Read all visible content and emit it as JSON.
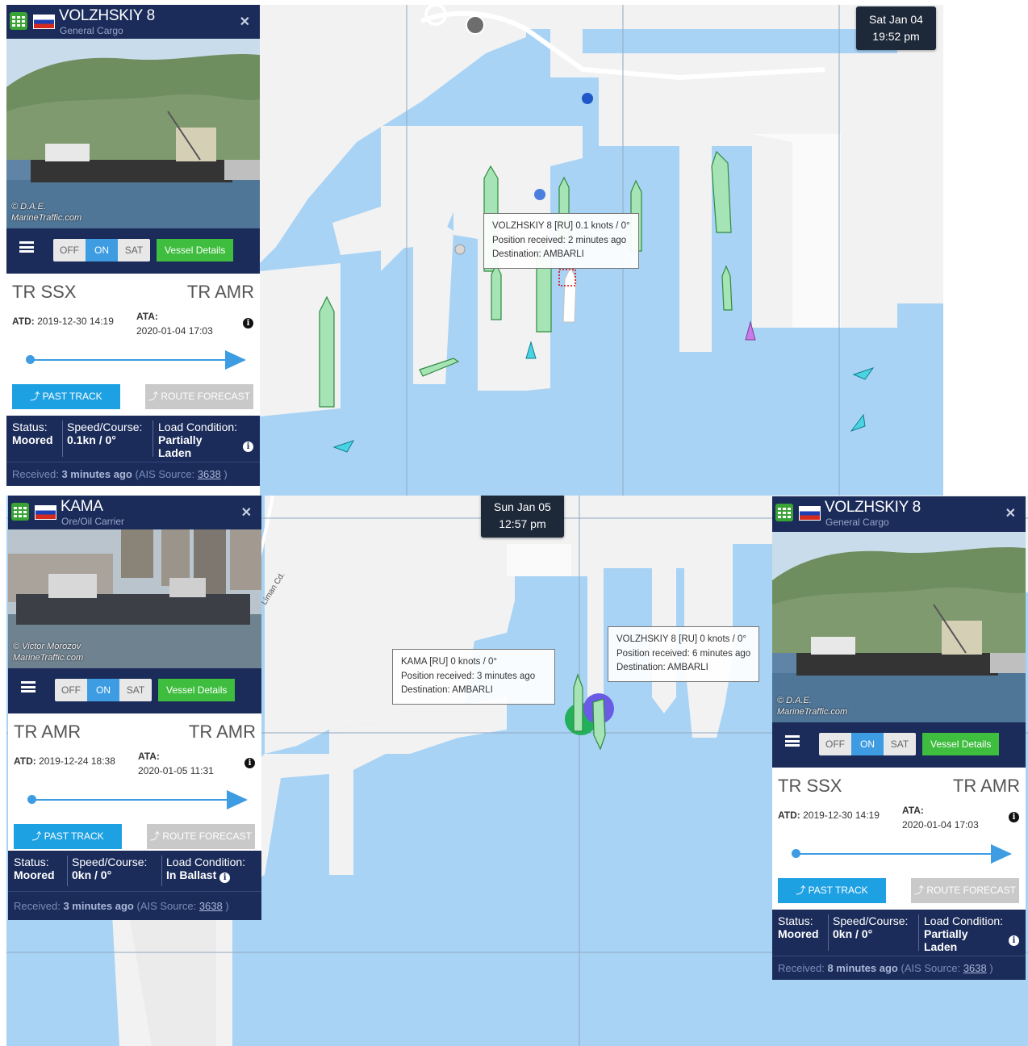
{
  "frames": {
    "top": {
      "clock": {
        "day": "Sat Jan 04",
        "time": "19:52 pm"
      },
      "tooltip": {
        "line1": "VOLZHSKIY 8 [RU] 0.1 knots / 0°",
        "line2": "Position received: 2 minutes ago",
        "line3": "Destination: AMBARLI"
      },
      "panel": {
        "name": "VOLZHSKIY 8",
        "type": "General Cargo",
        "photo_credit_1": "© D.A.E.",
        "photo_credit_2": "MarineTraffic.com",
        "toggle": [
          "OFF",
          "ON",
          "SAT"
        ],
        "toggle_active": "ON",
        "vessel_details": "Vessel Details",
        "from": "TR SSX",
        "to": "TR AMR",
        "atd_label": "ATD:",
        "atd_value": "2019-12-30 14:19",
        "ata_label": "ATA:",
        "ata_value": "2020-01-04 17:03",
        "past_track": "PAST TRACK",
        "route_forecast": "ROUTE FORECAST",
        "status_label": "Status:",
        "status_value": "Moored",
        "speed_label": "Speed/Course:",
        "speed_value": "0.1kn / 0°",
        "load_label": "Load Condition:",
        "load_value_1": "Partially",
        "load_value_2": "Laden",
        "received_label": "Received:",
        "received_value": "3 minutes ago",
        "ais_label": "(AIS Source:",
        "ais_value": "3638",
        "ais_close": ")"
      }
    },
    "bottom": {
      "clock": {
        "day": "Sun Jan 05",
        "time": "12:57 pm"
      },
      "road_label": "Liman Cd.",
      "tooltip_kama": {
        "line1": "KAMA [RU] 0 knots / 0°",
        "line2": "Position received: 3 minutes ago",
        "line3": "Destination: AMBARLI"
      },
      "tooltip_volz": {
        "line1": "VOLZHSKIY 8 [RU] 0 knots / 0°",
        "line2": "Position received: 6 minutes ago",
        "line3": "Destination: AMBARLI"
      },
      "panel_kama": {
        "name": "KAMA",
        "type": "Ore/Oil Carrier",
        "photo_credit_1": "© Victor Morozov",
        "photo_credit_2": "MarineTraffic.com",
        "toggle": [
          "OFF",
          "ON",
          "SAT"
        ],
        "vessel_details": "Vessel Details",
        "from": "TR AMR",
        "to": "TR AMR",
        "atd_label": "ATD:",
        "atd_value": "2019-12-24 18:38",
        "ata_label": "ATA:",
        "ata_value": "2020-01-05 11:31",
        "past_track": "PAST TRACK",
        "route_forecast": "ROUTE FORECAST",
        "status_label": "Status:",
        "status_value": "Moored",
        "speed_label": "Speed/Course:",
        "speed_value": "0kn / 0°",
        "load_label": "Load Condition:",
        "load_value_1": "In Ballast",
        "received_label": "Received:",
        "received_value": "3 minutes ago",
        "ais_label": "(AIS Source:",
        "ais_value": "3638",
        "ais_close": ")"
      },
      "panel_volz": {
        "name": "VOLZHSKIY 8",
        "type": "General Cargo",
        "photo_credit_1": "© D.A.E.",
        "photo_credit_2": "MarineTraffic.com",
        "toggle": [
          "OFF",
          "ON",
          "SAT"
        ],
        "vessel_details": "Vessel Details",
        "from": "TR SSX",
        "to": "TR AMR",
        "atd_label": "ATD:",
        "atd_value": "2019-12-30 14:19",
        "ata_label": "ATA:",
        "ata_value": "2020-01-04 17:03",
        "past_track": "PAST TRACK",
        "route_forecast": "ROUTE FORECAST",
        "status_label": "Status:",
        "status_value": "Moored",
        "speed_label": "Speed/Course:",
        "speed_value": "0kn / 0°",
        "load_label": "Load Condition:",
        "load_value_1": "Partially",
        "load_value_2": "Laden",
        "received_label": "Received:",
        "received_value": "8 minutes ago",
        "ais_label": "(AIS Source:",
        "ais_value": "3638",
        "ais_close": ")"
      }
    }
  },
  "colors": {
    "water": "#a8d3f5",
    "land": "#f2f2f2",
    "panel_navy": "#1b2c5a",
    "accent_blue": "#3d9ce2",
    "vessel_green": "#a6e3b5",
    "details_green": "#3ebd3e"
  }
}
